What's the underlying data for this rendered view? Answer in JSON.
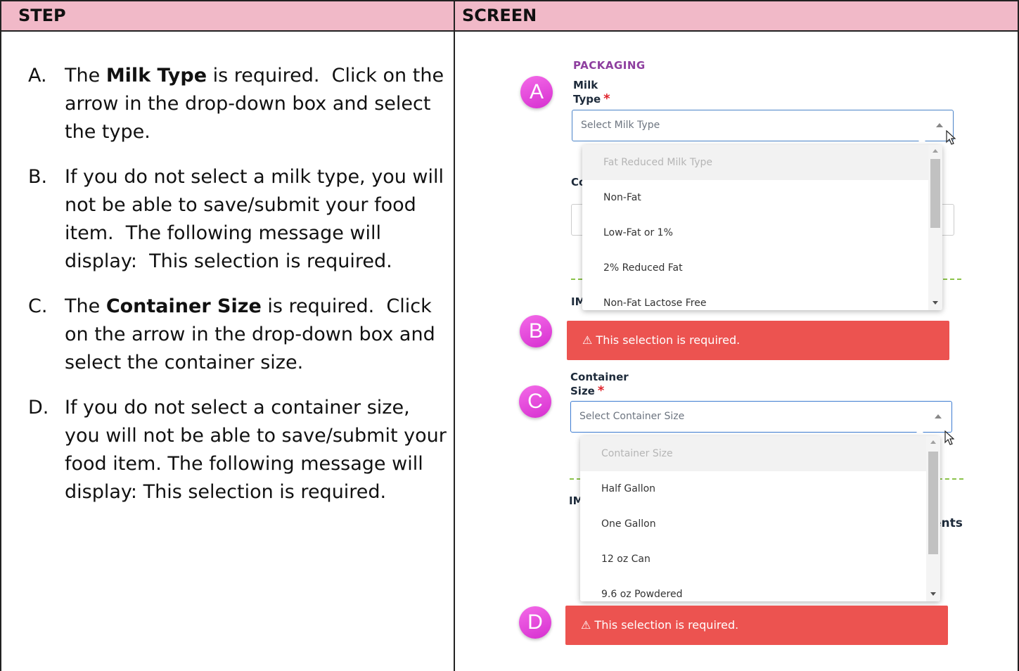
{
  "table": {
    "header_step": "STEP",
    "header_screen": "SCREEN"
  },
  "steps": [
    {
      "label": "A.",
      "pre": "The ",
      "bold": "Milk Type",
      "post": " is required.  Click on the arrow in the drop-down box and select the type."
    },
    {
      "label": "B.",
      "pre": "",
      "bold": "",
      "post": "If you do not select a milk type, you will not be able to save/submit your food item.  The following message will display:  This selection is required."
    },
    {
      "label": "C.",
      "pre": "The ",
      "bold": "Container Size",
      "post": " is required.  Click on the arrow in the drop-down box and select the container size."
    },
    {
      "label": "D.",
      "pre": "",
      "bold": "",
      "post": "If you do not select a container size, you will not be able to save/submit your food item. The following message will display: This selection is required."
    }
  ],
  "screen": {
    "section_heading": "PACKAGING",
    "milk_type_label": "Milk Type",
    "required_mark": "*",
    "milk_type_placeholder": "Select Milk Type",
    "milk_type_options": [
      "Fat Reduced Milk Type",
      "Non-Fat",
      "Low-Fat or 1%",
      "2% Reduced Fat",
      "Non-Fat Lactose Free"
    ],
    "error_message": "⚠ This selection is required.",
    "container_size_label": "Container Size",
    "container_size_placeholder": "Select Container Size",
    "container_size_options": [
      "Container Size",
      "Half Gallon",
      "One Gallon",
      "12 oz Can",
      "9.6 oz Powdered"
    ],
    "partial_text_co": "Co",
    "partial_text_im1": "IM",
    "partial_text_im2": "IM",
    "partial_text_nts": "ents",
    "badges": [
      "A",
      "B",
      "C",
      "D"
    ]
  },
  "colors": {
    "header_bg": "#f1b9c8",
    "badge": "#e546dc",
    "error_bg": "#ec5350",
    "section_heading": "#8e3f9f",
    "required": "#e0232b"
  }
}
